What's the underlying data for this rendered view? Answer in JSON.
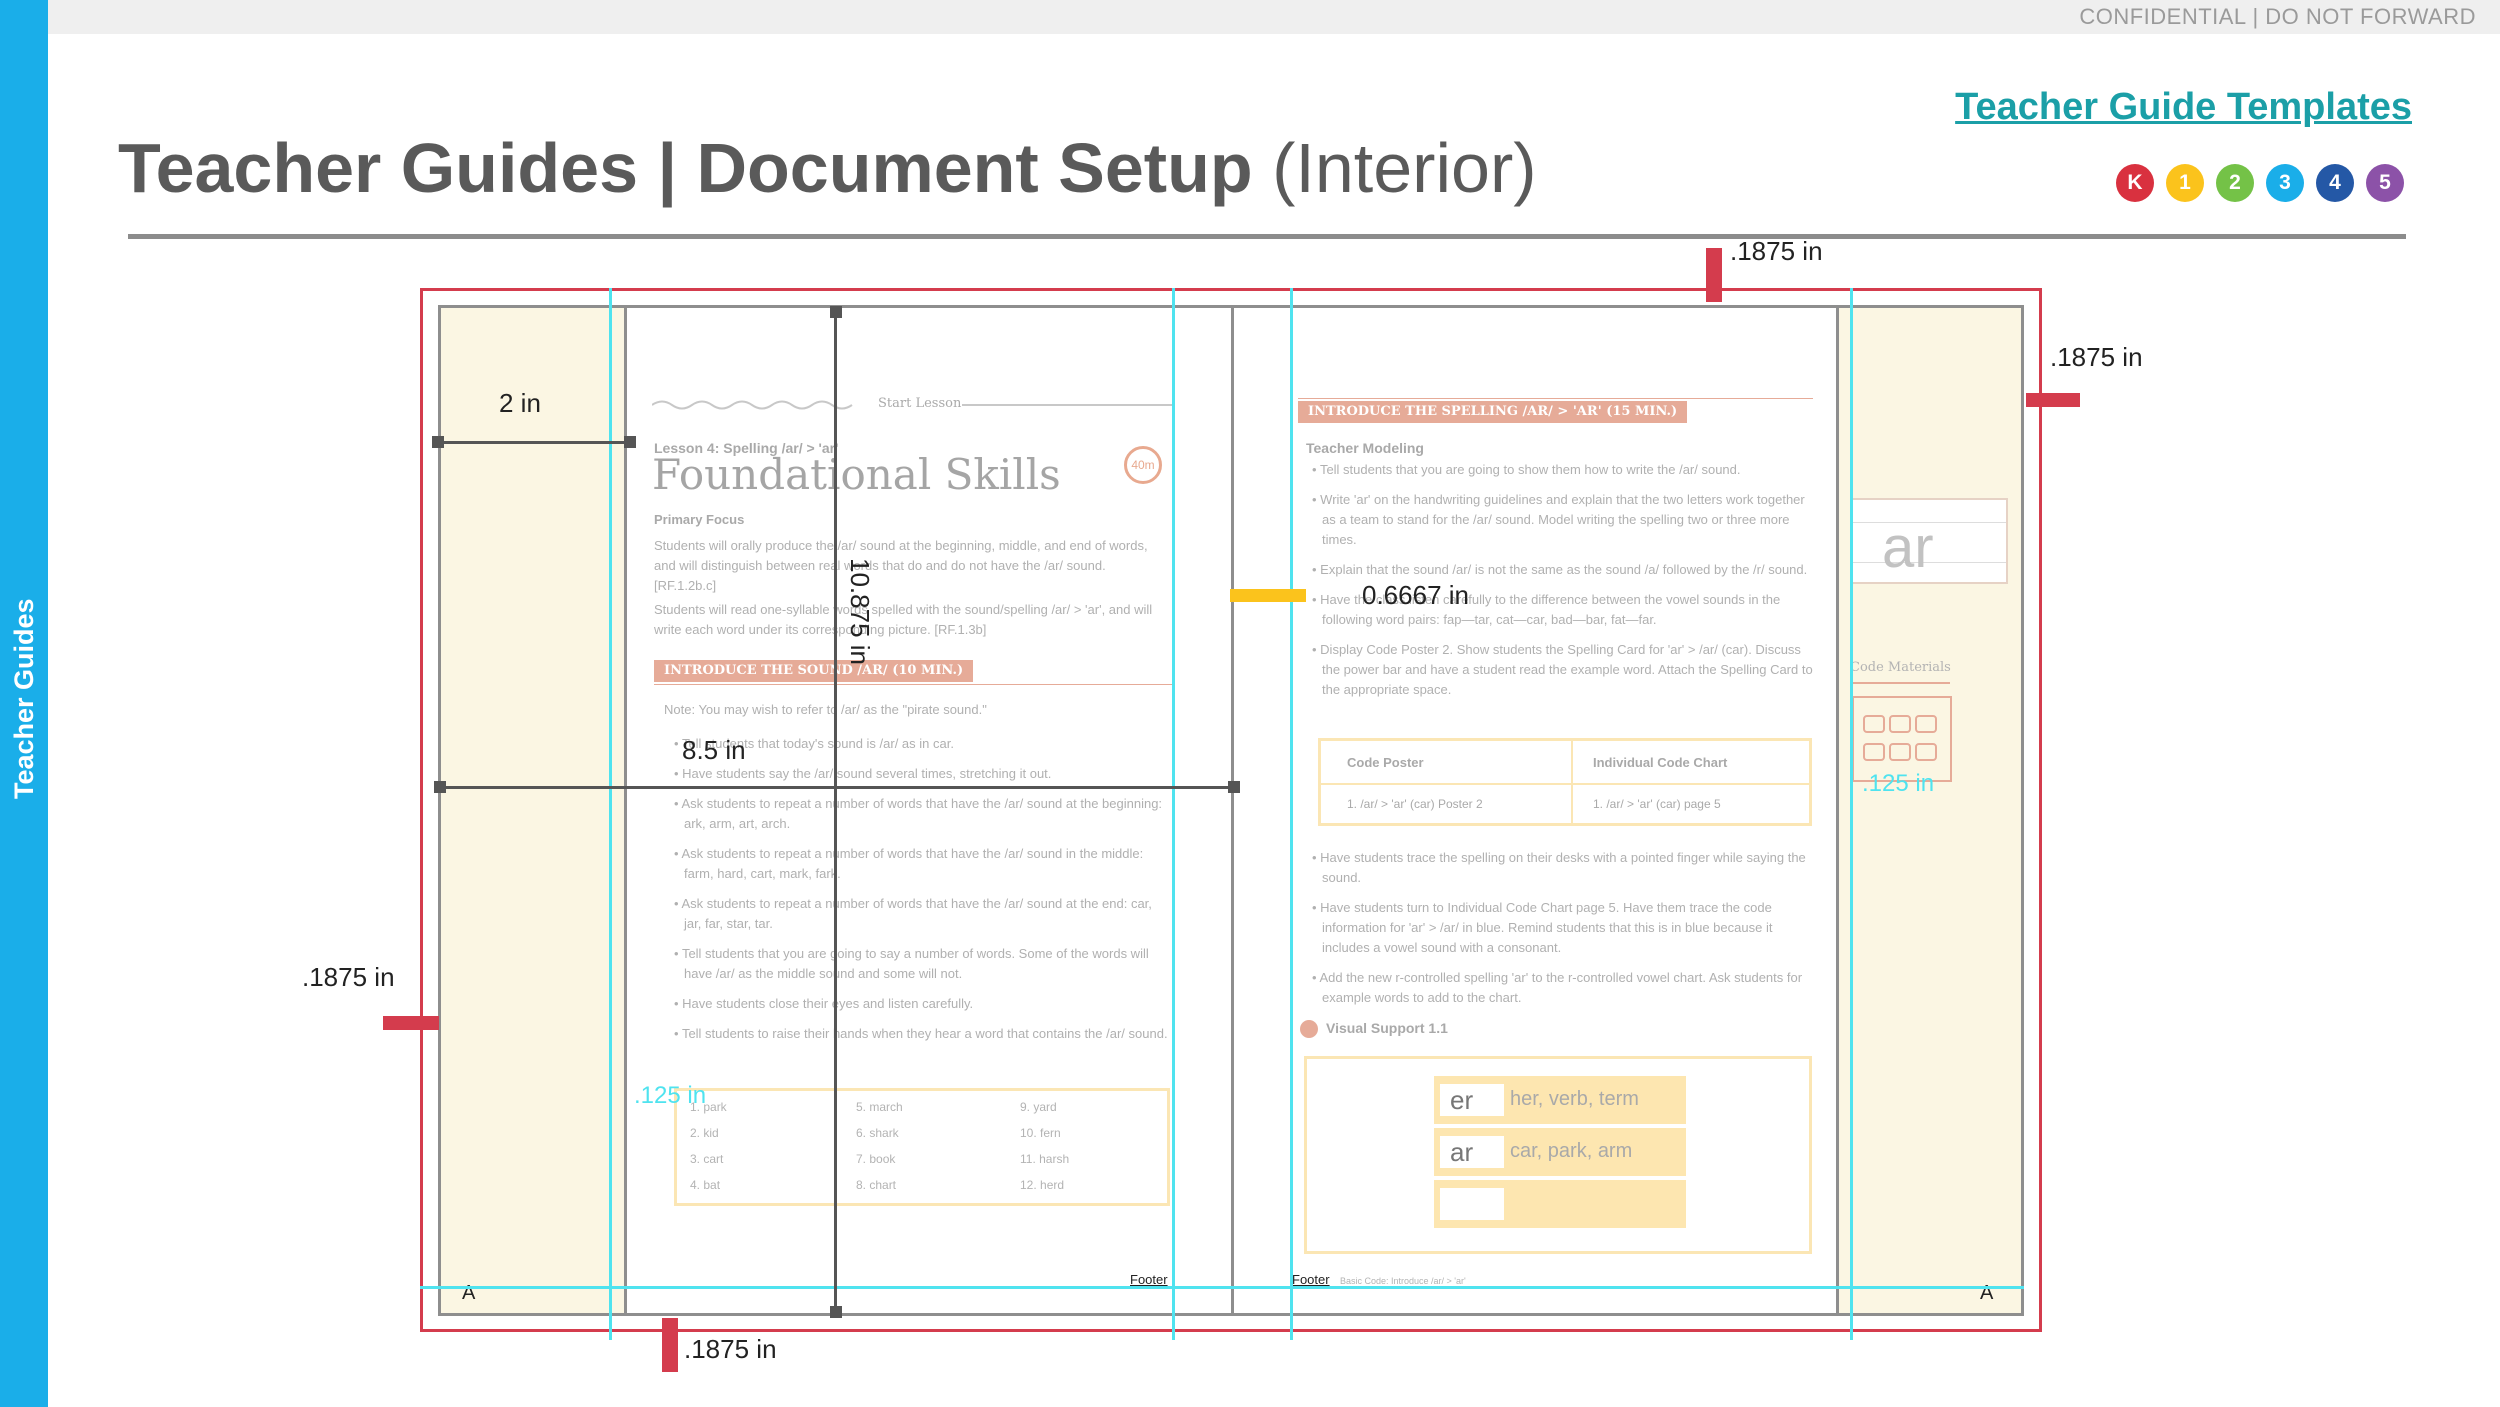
{
  "header": {
    "confidential": "CONFIDENTIAL | DO NOT FORWARD",
    "sidebar_label": "Teacher Guides",
    "title_bold": "Teacher Guides | Document Setup",
    "title_light": "(Interior)",
    "templates_link": "Teacher Guide Templates"
  },
  "grades": [
    {
      "label": "K",
      "color": "#d9313f"
    },
    {
      "label": "1",
      "color": "#fbc31c"
    },
    {
      "label": "2",
      "color": "#74c247"
    },
    {
      "label": "3",
      "color": "#1aaee9"
    },
    {
      "label": "4",
      "color": "#2458a6"
    },
    {
      "label": "5",
      "color": "#8c52a8"
    }
  ],
  "dimensions": {
    "top_bleed": ".1875 in",
    "right_bleed": ".1875 in",
    "left_bleed": ".1875 in",
    "bottom_bleed": ".1875 in",
    "sidebar_width": "2 in",
    "page_width": "8.5 in",
    "page_height": "10.875 in",
    "gutter": "0.6667 in",
    "margin_left": ".125 in",
    "margin_right": ".125 in"
  },
  "left_page": {
    "start_lesson": "Start Lesson",
    "lesson_label": "Lesson 4: Spelling /ar/ > 'ar'",
    "title": "Foundational Skills",
    "timer": "40m",
    "primary_focus": "Primary Focus",
    "focus_text_1": "Students will orally produce the /ar/ sound at the beginning, middle, and end of words, and will distinguish between real words that do and do not have the /ar/ sound.  [RF.1.2b.c]",
    "focus_text_2": "Students will read one-syllable words spelled with the sound/spelling /ar/ > 'ar', and will write each word under its corresponding picture.  [RF.1.3b]",
    "section_header": "INTRODUCE THE SOUND /AR/ (10 MIN.)",
    "note": "Note: You may wish to refer to /ar/ as the \"pirate sound.\"",
    "bullets": [
      "Tell students that today's sound is /ar/ as in car.",
      "Have students say the /ar/ sound several times, stretching it out.",
      "Ask students to repeat a number of words that have the /ar/ sound at the beginning: ark, arm, art, arch.",
      "Ask students to repeat a number of words that have the /ar/ sound in the middle: farm, hard, cart, mark, fark.",
      "Ask students to repeat a number of words that have the /ar/ sound at the end: car, jar, far, star, tar.",
      "Tell students that you are going to say a number of words. Some of the words will have /ar/ as the middle sound and some will not.",
      "Have students close their eyes and listen carefully.",
      "Tell students to raise their hands when they hear a word that contains the /ar/ sound."
    ],
    "word_list": [
      "1.   park",
      "2.   kid",
      "3.   cart",
      "4.   bat",
      "5.   march",
      "6.   shark",
      "7.   book",
      "8.   chart",
      "9.   yard",
      "10.  fern",
      "11.  harsh",
      "12.  herd"
    ],
    "footer": "Footer",
    "folio": "A"
  },
  "right_page": {
    "section_header": "INTRODUCE THE SPELLING /AR/ > 'AR' (15 MIN.)",
    "subhead": "Teacher Modeling",
    "bullets_1": [
      "Tell students that you are going to show them how to write the /ar/ sound.",
      "Write 'ar' on the handwriting guidelines and explain that the two letters work together as a team to stand for the /ar/ sound. Model writing the spelling two or three more times.",
      "Explain that the sound /ar/ is not the same as the sound /a/ followed by the /r/ sound.",
      "Have the class listen carefully to the difference between the vowel sounds in the following word pairs: fap—tar, cat—car, bad—bar, fat—far.",
      "Display Code Poster 2. Show students the Spelling Card for 'ar' > /ar/ (car). Discuss the power bar and have a student read the example word. Attach the Spelling Card to the appropriate space."
    ],
    "table_head_1": "Code Poster",
    "table_head_2": "Individual Code Chart",
    "table_cell_1": "1.   /ar/ > 'ar' (car) Poster 2",
    "table_cell_2": "1.   /ar/ > 'ar' (car) page 5",
    "bullets_2": [
      "Have students trace the spelling on their desks with a pointed finger while saying the sound.",
      "Have students turn to Individual Code Chart page 5. Have them trace the code information for 'ar' > /ar/ in blue. Remind students that this is in blue because it includes a vowel sound with a consonant.",
      "Add the new r-controlled spelling 'ar' to the r-controlled vowel chart. Ask students for example words to add to the chart."
    ],
    "visual_support": "Visual Support 1.1",
    "chart_rows": [
      {
        "spelling": "er",
        "words": "her, verb, term"
      },
      {
        "spelling": "ar",
        "words": "car, park, arm"
      },
      {
        "spelling": "",
        "words": ""
      }
    ],
    "footer": "Footer",
    "footer_note": "Basic Code: Introduce /ar/ > 'ar'",
    "folio": "A",
    "sidebar_ar": "ar",
    "code_materials": "Code Materials"
  }
}
